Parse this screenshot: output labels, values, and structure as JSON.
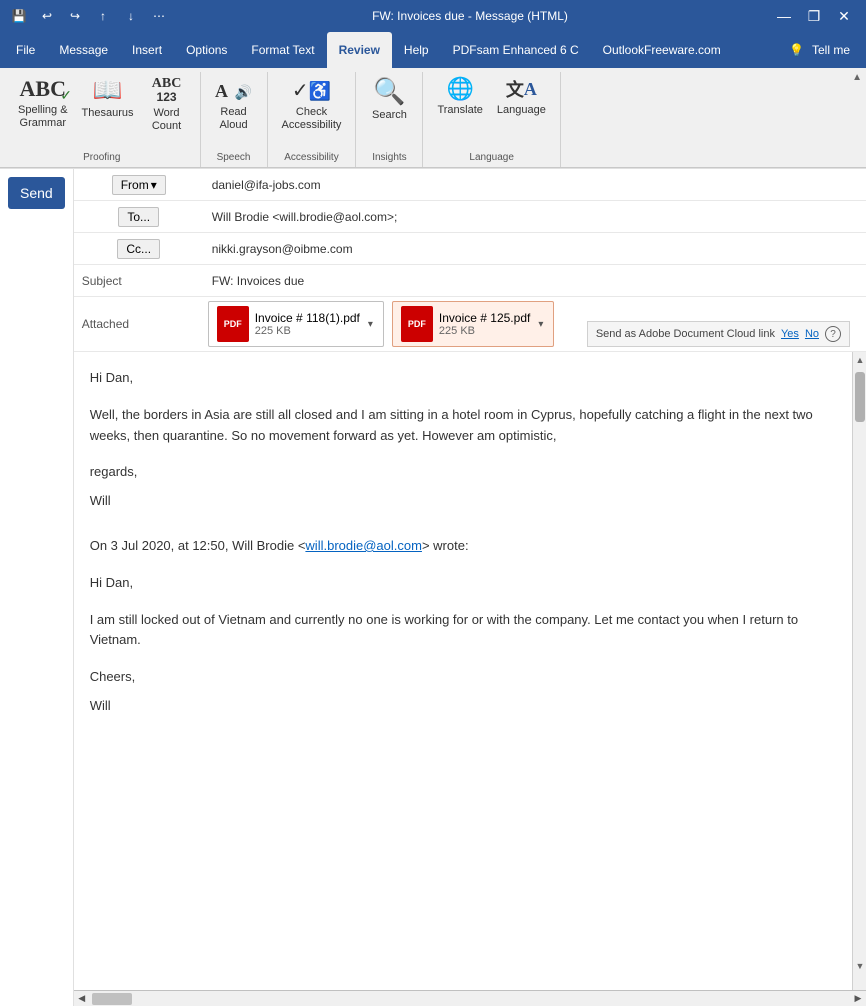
{
  "titleBar": {
    "title": "FW: Invoices due - Message (HTML)",
    "saveIcon": "💾",
    "undoIcon": "↩",
    "redoIcon": "↪",
    "upIcon": "↑",
    "downIcon": "↓",
    "moreIcon": "⋯",
    "minimizeIcon": "—",
    "restoreIcon": "❐",
    "closeIcon": "✕"
  },
  "ribbonTabs": {
    "tabs": [
      {
        "label": "File",
        "active": false
      },
      {
        "label": "Message",
        "active": false
      },
      {
        "label": "Insert",
        "active": false
      },
      {
        "label": "Options",
        "active": false
      },
      {
        "label": "Format Text",
        "active": false
      },
      {
        "label": "Review",
        "active": true
      },
      {
        "label": "Help",
        "active": false
      },
      {
        "label": "PDFsam Enhanced 6 C",
        "active": false
      },
      {
        "label": "OutlookFreeware.com",
        "active": false
      }
    ],
    "helpButton": "💡",
    "tellMeLabel": "Tell me"
  },
  "ribbon": {
    "groups": [
      {
        "name": "Proofing",
        "buttons": [
          {
            "icon": "ABC✓",
            "label": "Spelling &\nGrammar",
            "large": true
          },
          {
            "icon": "📖",
            "label": "Thesaurus",
            "large": true
          },
          {
            "icon": "ABC\n123",
            "label": "Word\nCount",
            "large": true
          }
        ]
      },
      {
        "name": "Speech",
        "buttons": [
          {
            "icon": "🔊",
            "label": "Read\nAloud",
            "large": true
          }
        ]
      },
      {
        "name": "Accessibility",
        "buttons": [
          {
            "icon": "✓♿",
            "label": "Check\nAccessibility",
            "large": true
          }
        ]
      },
      {
        "name": "Insights",
        "buttons": [
          {
            "icon": "🔍",
            "label": "Search",
            "large": true
          }
        ]
      },
      {
        "name": "Language",
        "buttons": [
          {
            "icon": "🌐A",
            "label": "Translate",
            "large": true
          },
          {
            "icon": "文A",
            "label": "Language",
            "large": true
          }
        ]
      }
    ]
  },
  "email": {
    "from": {
      "label": "From",
      "value": "daniel@ifa-jobs.com"
    },
    "to": {
      "label": "To...",
      "value": "Will Brodie <will.brodie@aol.com>;"
    },
    "cc": {
      "label": "Cc...",
      "value": "nikki.grayson@oibme.com"
    },
    "subject": {
      "label": "Subject",
      "value": "FW: Invoices due"
    },
    "attached": {
      "label": "Attached",
      "files": [
        {
          "name": "Invoice # 118(1).pdf",
          "size": "225 KB"
        },
        {
          "name": "Invoice # 125.pdf",
          "size": "225 KB"
        }
      ]
    },
    "adobeCloud": {
      "text": "Send as Adobe Document Cloud link",
      "yes": "Yes",
      "no": "No",
      "helpIcon": "?"
    },
    "body": {
      "greeting": "Hi Dan,",
      "paragraph1": "Well, the borders in Asia are still all closed and I am sitting in a hotel room in Cyprus, hopefully catching a flight in the next two weeks, then quarantine. So no movement forward as yet. However am optimistic,",
      "regards": "regards,",
      "signature1": "Will",
      "forwardInfo": "On 3 Jul 2020, at 12:50, Will Brodie <",
      "forwardEmail": "will.brodie@aol.com",
      "forwardSuffix": "> wrote:",
      "greeting2": "Hi Dan,",
      "paragraph2": "I am still locked out of Vietnam and currently no one is working for or with the company. Let me contact you when I return to Vietnam.",
      "cheers": "Cheers,",
      "signature2": "Will"
    }
  },
  "sendBtn": "Send"
}
